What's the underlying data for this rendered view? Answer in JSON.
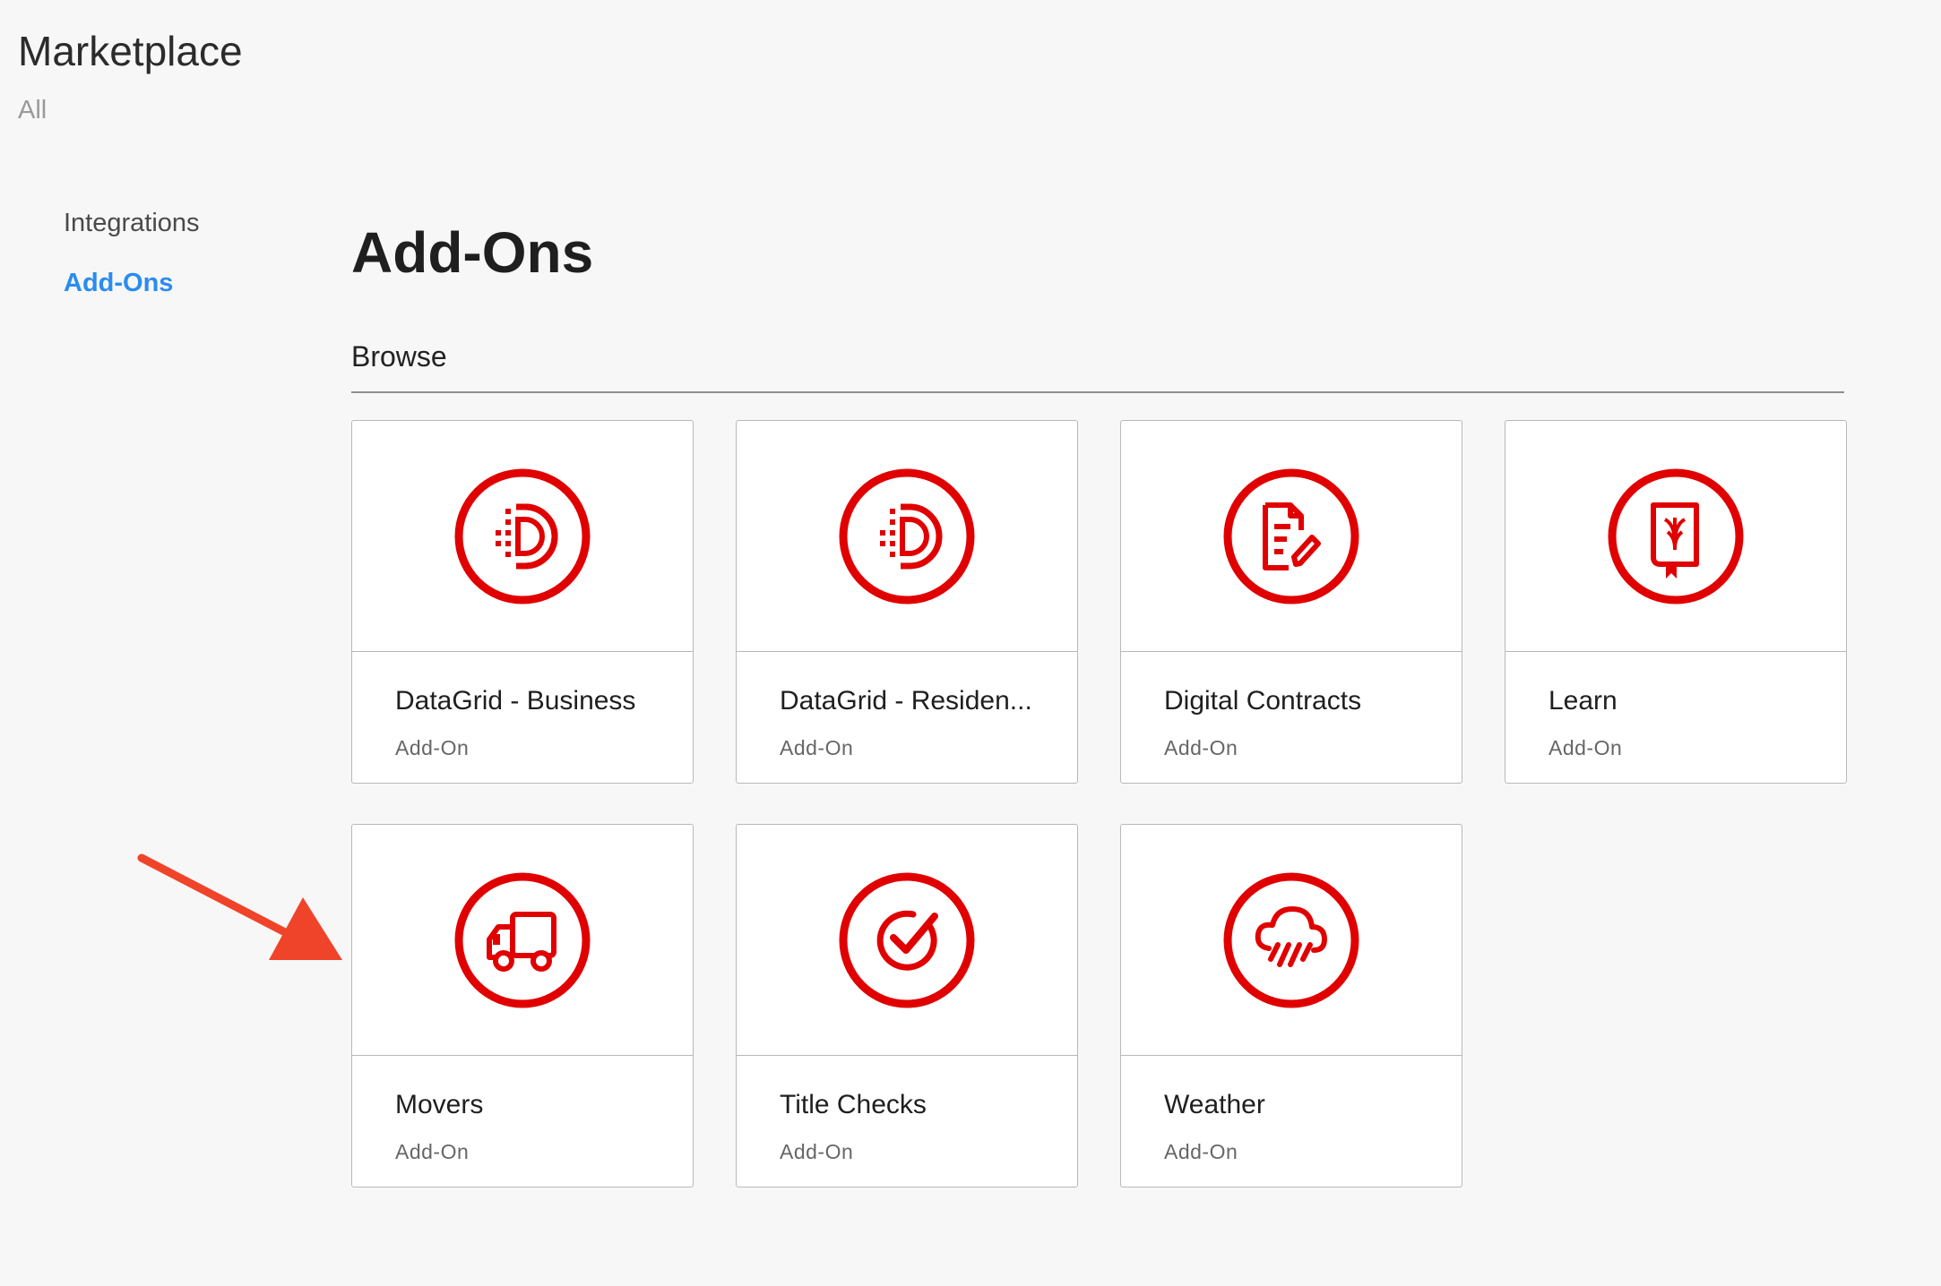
{
  "header": {
    "title": "Marketplace",
    "breadcrumb": "All"
  },
  "sidebar": {
    "items": [
      {
        "label": "Integrations"
      },
      {
        "label": "Add-Ons"
      }
    ]
  },
  "main": {
    "title": "Add-Ons",
    "section": "Browse",
    "cards": [
      {
        "name": "DataGrid - Business",
        "type": "Add-On",
        "icon": "datagrid-icon"
      },
      {
        "name": "DataGrid - Residen...",
        "type": "Add-On",
        "icon": "datagrid-icon"
      },
      {
        "name": "Digital Contracts",
        "type": "Add-On",
        "icon": "document-edit-icon"
      },
      {
        "name": "Learn",
        "type": "Add-On",
        "icon": "book-icon"
      },
      {
        "name": "Movers",
        "type": "Add-On",
        "icon": "truck-icon"
      },
      {
        "name": "Title Checks",
        "type": "Add-On",
        "icon": "checkmark-icon"
      },
      {
        "name": "Weather",
        "type": "Add-On",
        "icon": "rain-cloud-icon"
      }
    ]
  },
  "colors": {
    "brand_red": "#e00000",
    "active_link": "#2a8cf0",
    "arrow": "#f0442a"
  }
}
